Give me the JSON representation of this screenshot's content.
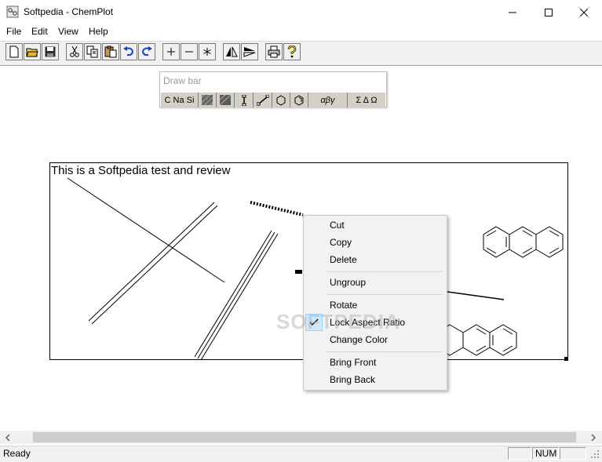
{
  "window": {
    "title": "Softpedia - ChemPlot",
    "app_icon": "chemplot-app-icon",
    "controls": [
      "minimize-icon",
      "maximize-icon",
      "close-icon"
    ]
  },
  "menubar": {
    "items": [
      "File",
      "Edit",
      "View",
      "Help"
    ]
  },
  "toolbar": {
    "buttons": [
      "new-file-icon",
      "open-folder-icon",
      "save-icon",
      "cut-icon",
      "copy-icon",
      "paste-icon",
      "undo-icon",
      "redo-icon",
      "zoom-in-icon",
      "zoom-out-icon",
      "asterisk-icon",
      "flip-horizontal-icon",
      "flip-vertical-icon",
      "print-icon",
      "help-icon"
    ]
  },
  "drawbar": {
    "title": "Draw bar",
    "tools": [
      "C Na Si",
      "αβγ",
      "Σ Δ Ω"
    ],
    "icons": [
      "pattern-dense-icon",
      "pattern-dark-icon",
      "bond-vertical-icon",
      "bond-diagonal-icon",
      "ring-hexagon-icon",
      "ring-benzene-icon"
    ]
  },
  "canvas": {
    "caption": "This is a Softpedia test and review"
  },
  "context_menu": {
    "items": [
      {
        "label": "Cut"
      },
      {
        "label": "Copy"
      },
      {
        "label": "Delete"
      },
      {
        "label": "Ungroup"
      },
      {
        "label": "Rotate"
      },
      {
        "label": "Lock Aspect Ratio",
        "checked": true
      },
      {
        "label": "Change Color"
      },
      {
        "label": "Bring Front"
      },
      {
        "label": "Bring Back"
      }
    ]
  },
  "statusbar": {
    "text": "Ready",
    "panes": [
      "",
      "NUM",
      ""
    ]
  },
  "watermark": "SOFTPEDIA"
}
